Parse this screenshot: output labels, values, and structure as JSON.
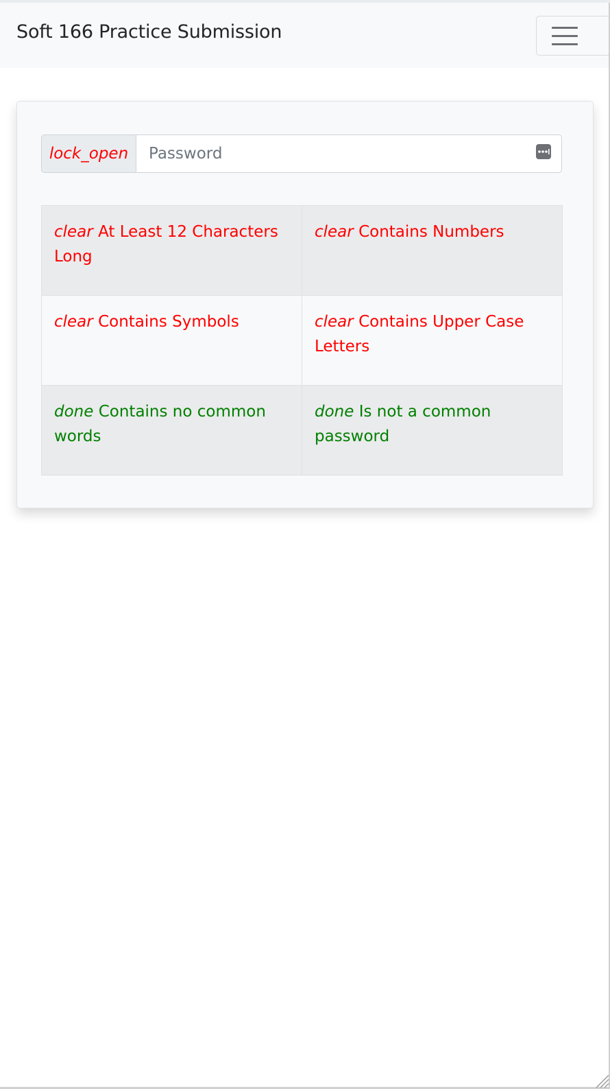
{
  "navbar": {
    "brand": "Soft 166 Practice Submission",
    "toggler_icon": "hamburger-menu-icon"
  },
  "password": {
    "addon_icon_text": "lock_open",
    "placeholder": "Password",
    "value": "",
    "manager_icon": "password-dots-icon"
  },
  "requirements": [
    {
      "status_icon": "clear",
      "label": "At Least 12 Characters Long",
      "met": false
    },
    {
      "status_icon": "clear",
      "label": "Contains Numbers",
      "met": false
    },
    {
      "status_icon": "clear",
      "label": "Contains Symbols",
      "met": false
    },
    {
      "status_icon": "clear",
      "label": "Contains Upper Case Letters",
      "met": false
    },
    {
      "status_icon": "done",
      "label": "Contains no common words",
      "met": true
    },
    {
      "status_icon": "done",
      "label": "Is not a common password",
      "met": true
    }
  ],
  "colors": {
    "fail": "#ff0000",
    "pass": "#008000"
  }
}
